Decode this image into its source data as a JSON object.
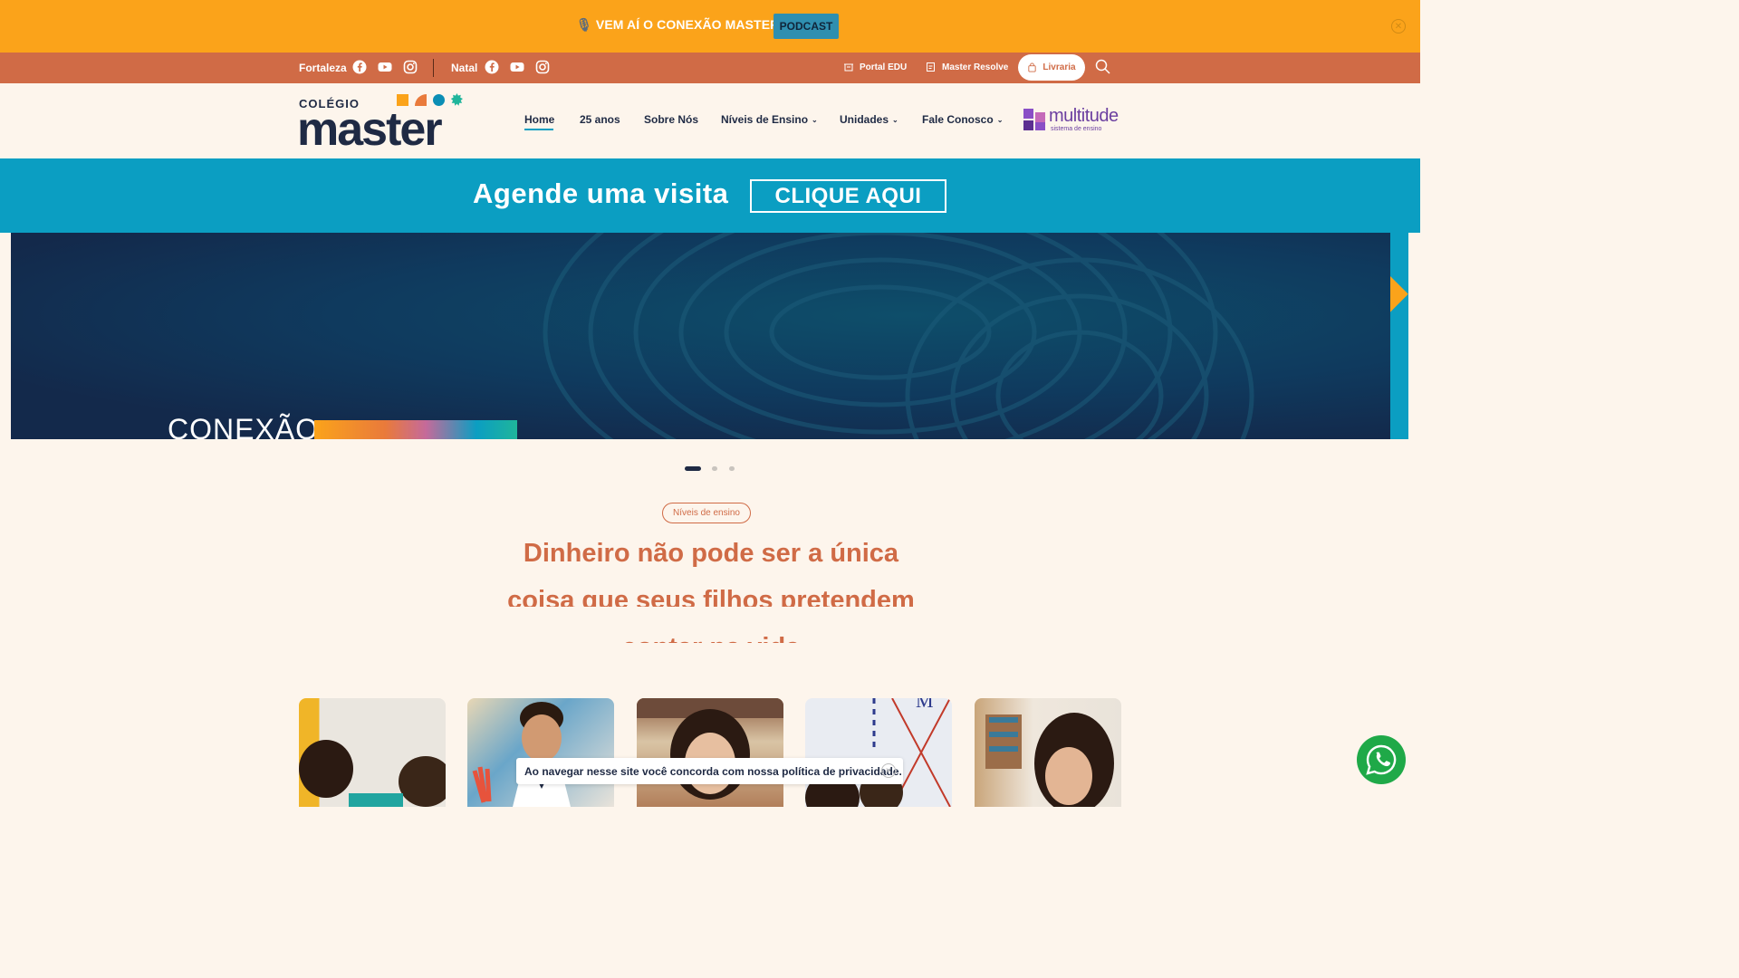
{
  "announcement": {
    "text": "VEM AÍ O CONEXÃO MASTER",
    "button": "PODCAST",
    "close": "✕"
  },
  "topbar": {
    "city1": "Fortaleza",
    "city2": "Natal",
    "portal": "Portal EDU",
    "resolve": "Master Resolve",
    "livraria": "Livraria"
  },
  "logo": {
    "small": "COLÉGIO",
    "big": "master"
  },
  "nav": {
    "items": [
      "Home",
      "25 anos",
      "Sobre Nós",
      "Níveis de Ensino",
      "Unidades",
      "Fale Conosco"
    ],
    "chevron": "⌄"
  },
  "multitude": {
    "name": "multitude",
    "sub": "sistema de ensino"
  },
  "cta": {
    "title": "Agende uma visita",
    "button": "CLIQUE AQUI"
  },
  "hero": {
    "caption": "CONEXÃO",
    "active_slide": 1,
    "slide_count": 3
  },
  "section": {
    "badge": "Níveis de ensino",
    "headline": "Dinheiro não pode ser a única coisa que seus filhos pretendem contar na vida"
  },
  "cookie": {
    "text": "Ao navegar nesse site você concorda com nossa política de privacidade.",
    "close": "✕"
  },
  "colors": {
    "announcement": "#fba31a",
    "topbar": "#d06b46",
    "cta": "#0b9ec2",
    "brand_navy": "#1f2a44",
    "whatsapp": "#1fa948"
  }
}
